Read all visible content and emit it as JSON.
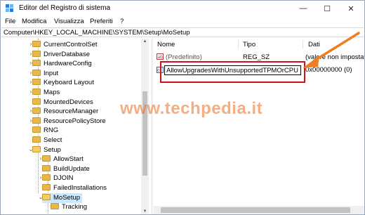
{
  "window": {
    "title": "Editor del Registro di sistema",
    "minimize_glyph": "—",
    "maximize_glyph": "☐",
    "close_glyph": "✕"
  },
  "menu": [
    "File",
    "Modifica",
    "Visualizza",
    "Preferiti",
    "?"
  ],
  "address": "Computer\\HKEY_LOCAL_MACHINE\\SYSTEM\\Setup\\MoSetup",
  "tree": {
    "items": [
      {
        "label": "CurrentControlSet",
        "level": 0,
        "chevron": "›"
      },
      {
        "label": "DriverDatabase",
        "level": 0,
        "chevron": "›"
      },
      {
        "label": "HardwareConfig",
        "level": 0,
        "chevron": "›"
      },
      {
        "label": "Input",
        "level": 0,
        "chevron": "›"
      },
      {
        "label": "Keyboard Layout",
        "level": 0,
        "chevron": "›"
      },
      {
        "label": "Maps",
        "level": 0,
        "chevron": "›"
      },
      {
        "label": "MountedDevices",
        "level": 0,
        "chevron": ""
      },
      {
        "label": "ResourceManager",
        "level": 0,
        "chevron": "›"
      },
      {
        "label": "ResourcePolicyStore",
        "level": 0,
        "chevron": "›"
      },
      {
        "label": "RNG",
        "level": 0,
        "chevron": ""
      },
      {
        "label": "Select",
        "level": 0,
        "chevron": ""
      },
      {
        "label": "Setup",
        "level": 0,
        "chevron": "⌄"
      },
      {
        "label": "AllowStart",
        "level": 1,
        "chevron": "›"
      },
      {
        "label": "BuildUpdate",
        "level": 1,
        "chevron": ""
      },
      {
        "label": "DJOIN",
        "level": 1,
        "chevron": "›"
      },
      {
        "label": "FailedInstallations",
        "level": 1,
        "chevron": ""
      },
      {
        "label": "MoSetup",
        "level": 1,
        "chevron": "⌄",
        "selected": true
      },
      {
        "label": "Tracking",
        "level": 2,
        "chevron": ""
      }
    ]
  },
  "list": {
    "columns": [
      "Nome",
      "Tipo",
      "Dati"
    ],
    "rows": [
      {
        "name": "(Predefinito)",
        "type": "REG_SZ",
        "data": "(valore non impostato)"
      },
      {
        "name": "AllowUpgradesWithUnsupportedTPMOrCPU",
        "type": "",
        "data": "0x00000000 (0)"
      }
    ]
  },
  "watermark": "www.techpedia.it",
  "colors": {
    "highlight": "#d0101b",
    "arrow": "#f07d1f",
    "selection": "#cce8ff",
    "folder": "#e8b94a"
  }
}
